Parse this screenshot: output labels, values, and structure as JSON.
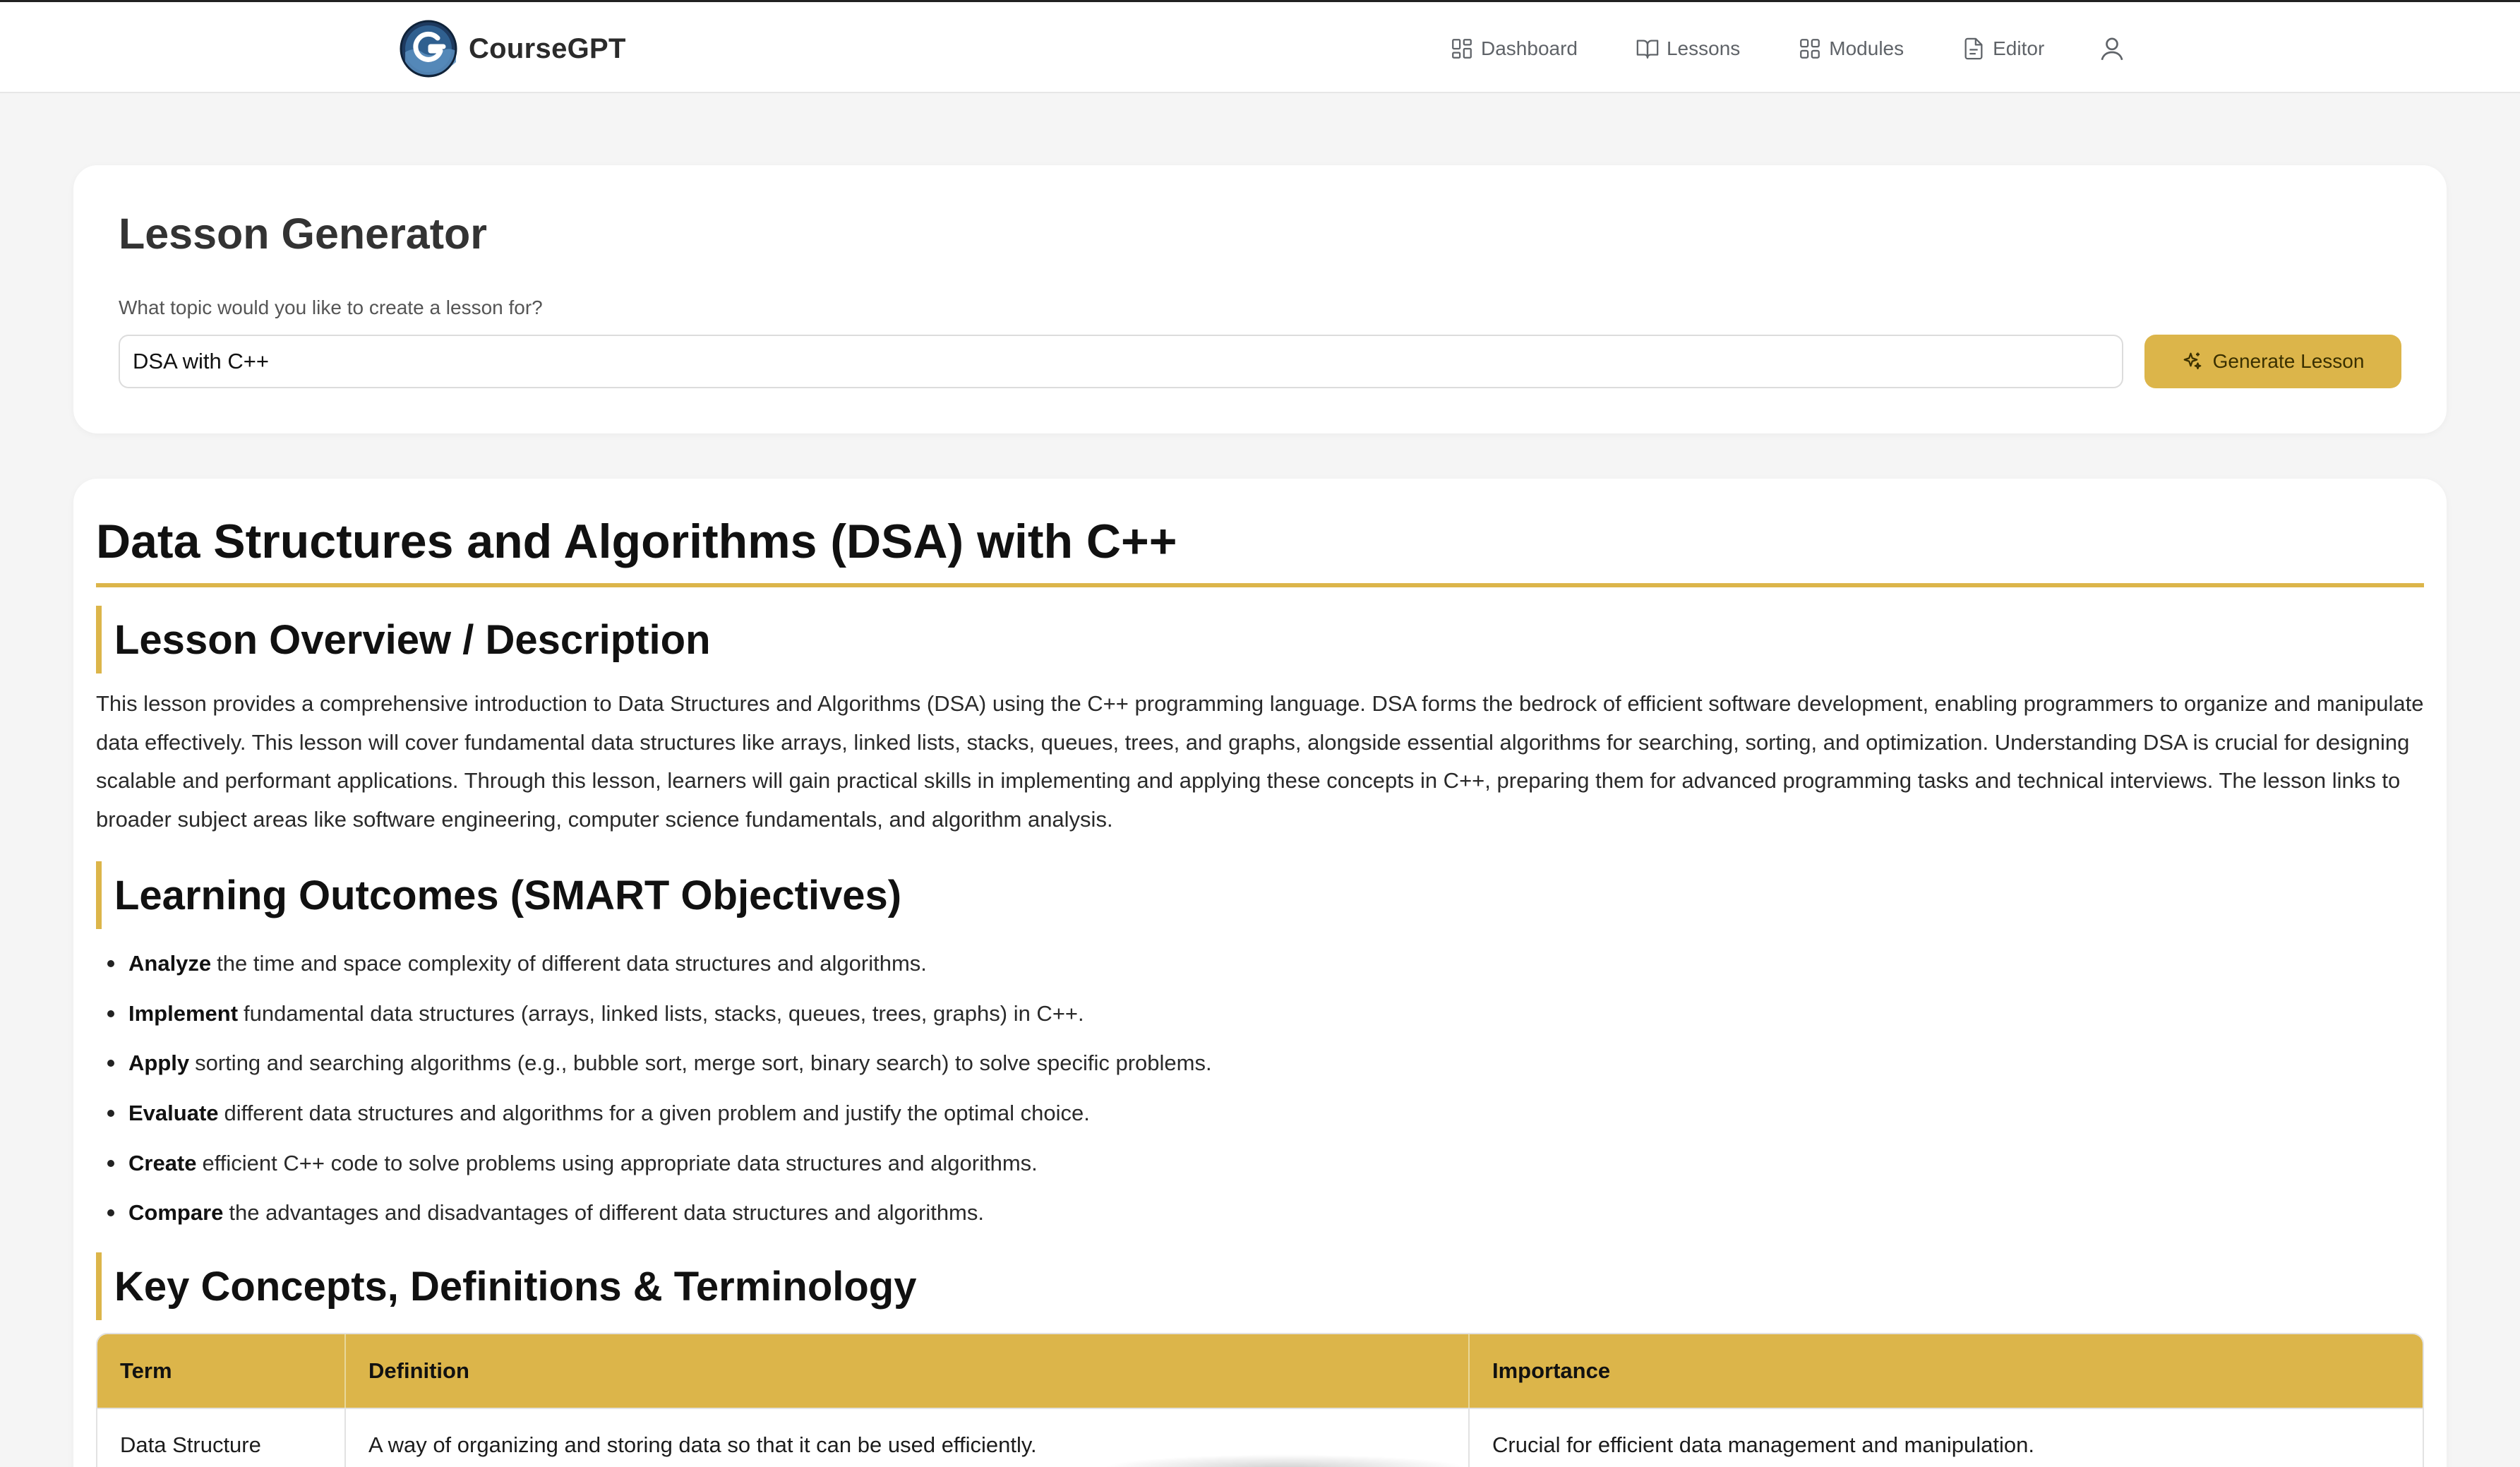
{
  "app": {
    "name": "CourseGPT"
  },
  "nav": {
    "items": [
      {
        "label": "Dashboard",
        "icon": "dashboard-icon"
      },
      {
        "label": "Lessons",
        "icon": "book-icon"
      },
      {
        "label": "Modules",
        "icon": "modules-icon"
      },
      {
        "label": "Editor",
        "icon": "document-icon"
      }
    ],
    "user_icon": "user-icon"
  },
  "generator": {
    "title": "Lesson Generator",
    "label": "What topic would you like to create a lesson for?",
    "input_value": "DSA with C++",
    "button_label": "Generate Lesson",
    "button_icon": "sparkle-icon"
  },
  "lesson": {
    "title": "Data Structures and Algorithms (DSA) with C++",
    "overview_heading": "Lesson Overview / Description",
    "overview_text": "This lesson provides a comprehensive introduction to Data Structures and Algorithms (DSA) using the C++ programming language. DSA forms the bedrock of efficient software development, enabling programmers to organize and manipulate data effectively. This lesson will cover fundamental data structures like arrays, linked lists, stacks, queues, trees, and graphs, alongside essential algorithms for searching, sorting, and optimization. Understanding DSA is crucial for designing scalable and performant applications. Through this lesson, learners will gain practical skills in implementing and applying these concepts in C++, preparing them for advanced programming tasks and technical interviews. The lesson links to broader subject areas like software engineering, computer science fundamentals, and algorithm analysis.",
    "outcomes_heading": "Learning Outcomes (SMART Objectives)",
    "outcomes": [
      {
        "verb": "Analyze",
        "text": "the time and space complexity of different data structures and algorithms."
      },
      {
        "verb": "Implement",
        "text": "fundamental data structures (arrays, linked lists, stacks, queues, trees, graphs) in C++."
      },
      {
        "verb": "Apply",
        "text": "sorting and searching algorithms (e.g., bubble sort, merge sort, binary search) to solve specific problems."
      },
      {
        "verb": "Evaluate",
        "text": "different data structures and algorithms for a given problem and justify the optimal choice."
      },
      {
        "verb": "Create",
        "text": "efficient C++ code to solve problems using appropriate data structures and algorithms."
      },
      {
        "verb": "Compare",
        "text": "the advantages and disadvantages of different data structures and algorithms."
      }
    ],
    "concepts_heading": "Key Concepts, Definitions & Terminology",
    "table": {
      "headers": [
        "Term",
        "Definition",
        "Importance"
      ],
      "rows": [
        [
          "Data Structure",
          "A way of organizing and storing data so that it can be used efficiently.",
          "Crucial for efficient data management and manipulation."
        ]
      ]
    }
  },
  "colors": {
    "accent": "#dcb54a",
    "background": "#f5f5f5",
    "card": "#ffffff"
  }
}
